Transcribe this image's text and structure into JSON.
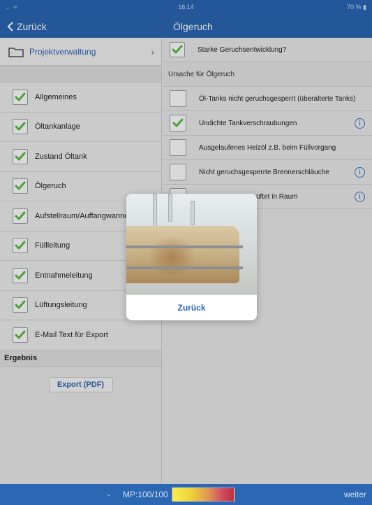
{
  "status": {
    "left": "← ≈",
    "time": "16:14",
    "battery": "70 % ▮"
  },
  "nav": {
    "back_label": "Zurück",
    "title": "Ölgeruch"
  },
  "sidebar": {
    "project_label": "Projektverwaltung",
    "items": [
      {
        "label": "Allgemeines",
        "checked": true
      },
      {
        "label": "Öltankanlage",
        "checked": true
      },
      {
        "label": "Zustand Öltank",
        "checked": true
      },
      {
        "label": "Ölgeruch",
        "checked": true
      },
      {
        "label": "Aufstellraum/Auffangwanne",
        "checked": true
      },
      {
        "label": "Füllleitung",
        "checked": true
      },
      {
        "label": "Entnahmeleitung",
        "checked": true
      },
      {
        "label": "Lüftungsleitung",
        "checked": true
      },
      {
        "label": "E-Mail Text für Export",
        "checked": true
      }
    ],
    "result_header": "Ergebnis",
    "export_label": "Export (PDF)"
  },
  "main": {
    "top_question": {
      "label": "Starke Geruchsentwicklung?",
      "checked": true
    },
    "section_header": "Ursache für Ölgeruch",
    "rows": [
      {
        "label": "Öl-Tanks nicht geruchsgesperrt (überalterte Tanks)",
        "checked": false,
        "info": false
      },
      {
        "label": "Undichte Tankverschraubungen",
        "checked": true,
        "info": true
      },
      {
        "label": "Ausgelaufenes Heizöl z.B. beim Füllvorgang",
        "checked": false,
        "info": false
      },
      {
        "label": "Nicht geruchsgesperrte Brennerschläuche",
        "checked": false,
        "info": true
      },
      {
        "label": "üftet in Raum",
        "checked": false,
        "info": true
      }
    ]
  },
  "popup": {
    "button_label": "Zurück"
  },
  "bottom": {
    "dash": "-",
    "mp_label": "MP:100/100",
    "next_label": "weiter"
  },
  "colors": {
    "bar": "#2b67b3",
    "accent": "#2a66b5",
    "check": "#5cb946"
  }
}
